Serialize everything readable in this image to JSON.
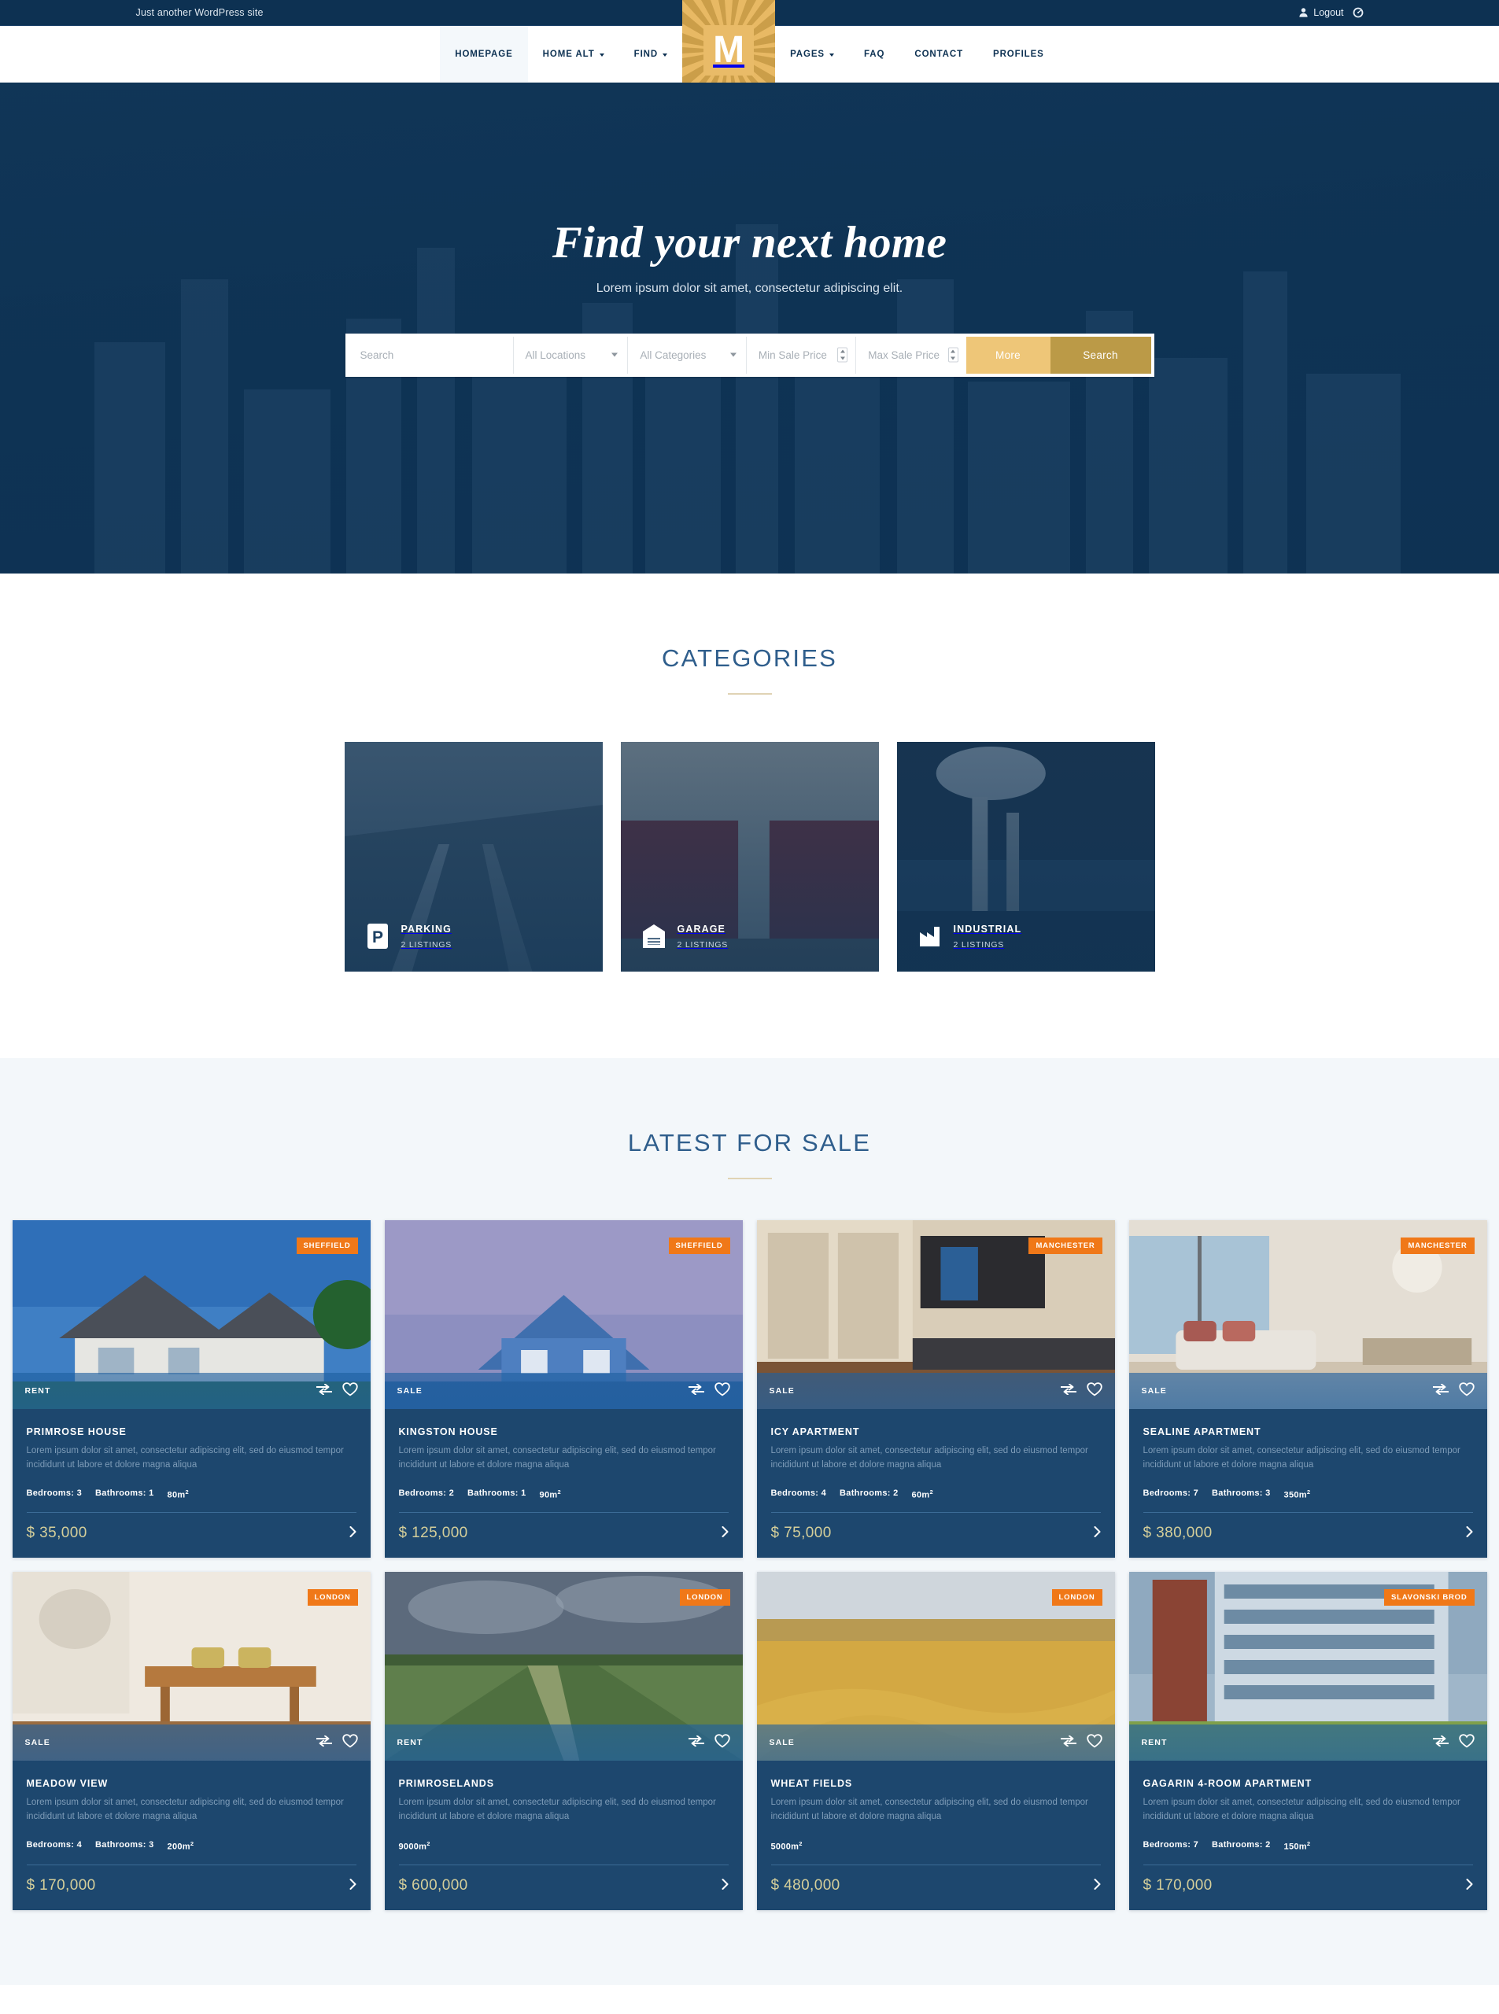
{
  "topbar": {
    "tagline": "Just another WordPress site",
    "user_icon": "user-icon",
    "logout_label": "Logout",
    "dashboard_icon": "dashboard-icon"
  },
  "nav": {
    "logo_letter": "M",
    "left_items": [
      {
        "label": "HOMEPAGE",
        "has_caret": false,
        "active": true
      },
      {
        "label": "HOME ALT",
        "has_caret": true,
        "active": false
      },
      {
        "label": "FIND",
        "has_caret": true,
        "active": false
      }
    ],
    "right_items": [
      {
        "label": "PAGES",
        "has_caret": true,
        "active": false
      },
      {
        "label": "FAQ",
        "has_caret": false,
        "active": false
      },
      {
        "label": "CONTACT",
        "has_caret": false,
        "active": false
      },
      {
        "label": "PROFILES",
        "has_caret": false,
        "active": false
      }
    ]
  },
  "hero": {
    "title": "Find your next home",
    "subtitle": "Lorem ipsum dolor sit amet, consectetur adipiscing elit.",
    "search": {
      "keyword_placeholder": "Search",
      "location_value": "All Locations",
      "category_value": "All Categories",
      "min_price_placeholder": "Min Sale Price",
      "max_price_placeholder": "Max Sale Price",
      "more_label": "More",
      "search_label": "Search"
    }
  },
  "categories_section": {
    "title": "CATEGORIES",
    "items": [
      {
        "name": "PARKING",
        "count": "2 LISTINGS",
        "icon": "parking-sign-icon"
      },
      {
        "name": "GARAGE",
        "count": "2 LISTINGS",
        "icon": "garage-icon"
      },
      {
        "name": "INDUSTRIAL",
        "count": "2 LISTINGS",
        "icon": "factory-icon"
      }
    ]
  },
  "listings_section": {
    "title": "LATEST FOR SALE",
    "description": "Lorem ipsum dolor sit amet, consectetur adipiscing elit, sed do eiusmod tempor incididunt ut labore et dolore magna aliqua",
    "compare_icon": "compare-arrows-icon",
    "favorite_icon": "heart-icon",
    "chevron_icon": "chevron-right-icon",
    "items": [
      {
        "title": "PRIMROSE HOUSE",
        "status": "RENT",
        "location": "SHEFFIELD",
        "bedrooms": "Bedrooms: 3",
        "bathrooms": "Bathrooms: 1",
        "area": "80m",
        "price": "$ 35,000",
        "photo": "suburban-white-house"
      },
      {
        "title": "KINGSTON HOUSE",
        "status": "SALE",
        "location": "SHEFFIELD",
        "bedrooms": "Bedrooms: 2",
        "bathrooms": "Bathrooms: 1",
        "area": "90m",
        "price": "$ 125,000",
        "photo": "blue-clapboard-house"
      },
      {
        "title": "ICY APARTMENT",
        "status": "SALE",
        "location": "MANCHESTER",
        "bedrooms": "Bedrooms: 4",
        "bathrooms": "Bathrooms: 2",
        "area": "60m",
        "price": "$ 75,000",
        "photo": "modern-kitchen-island"
      },
      {
        "title": "SEALINE APARTMENT",
        "status": "SALE",
        "location": "MANCHESTER",
        "bedrooms": "Bedrooms: 7",
        "bathrooms": "Bathrooms: 3",
        "area": "350m",
        "price": "$ 380,000",
        "photo": "living-room-panorama"
      },
      {
        "title": "MEADOW VIEW",
        "status": "SALE",
        "location": "LONDON",
        "bedrooms": "Bedrooms: 4",
        "bathrooms": "Bathrooms: 3",
        "area": "200m",
        "price": "$ 170,000",
        "photo": "wood-dining-kitchen"
      },
      {
        "title": "PRIMROSELANDS",
        "status": "RENT",
        "location": "LONDON",
        "bedrooms": "",
        "bathrooms": "",
        "area": "9000m",
        "price": "$ 600,000",
        "photo": "vineyard-rows"
      },
      {
        "title": "WHEAT FIELDS",
        "status": "SALE",
        "location": "LONDON",
        "bedrooms": "",
        "bathrooms": "",
        "area": "5000m",
        "price": "$ 480,000",
        "photo": "golden-wheat-field"
      },
      {
        "title": "GAGARIN 4-ROOM APARTMENT",
        "status": "RENT",
        "location": "SLAVONSKI BROD",
        "bedrooms": "Bedrooms: 7",
        "bathrooms": "Bathrooms: 2",
        "area": "150m",
        "price": "$ 170,000",
        "photo": "glass-office-building"
      }
    ]
  },
  "colors": {
    "navy": "#0d3152",
    "card_navy": "#1d476e",
    "gold": "#e8b964",
    "gold_dark": "#bb9a47",
    "orange": "#f07818",
    "price": "#d5cf9a",
    "section_light": "#f3f7fa"
  }
}
